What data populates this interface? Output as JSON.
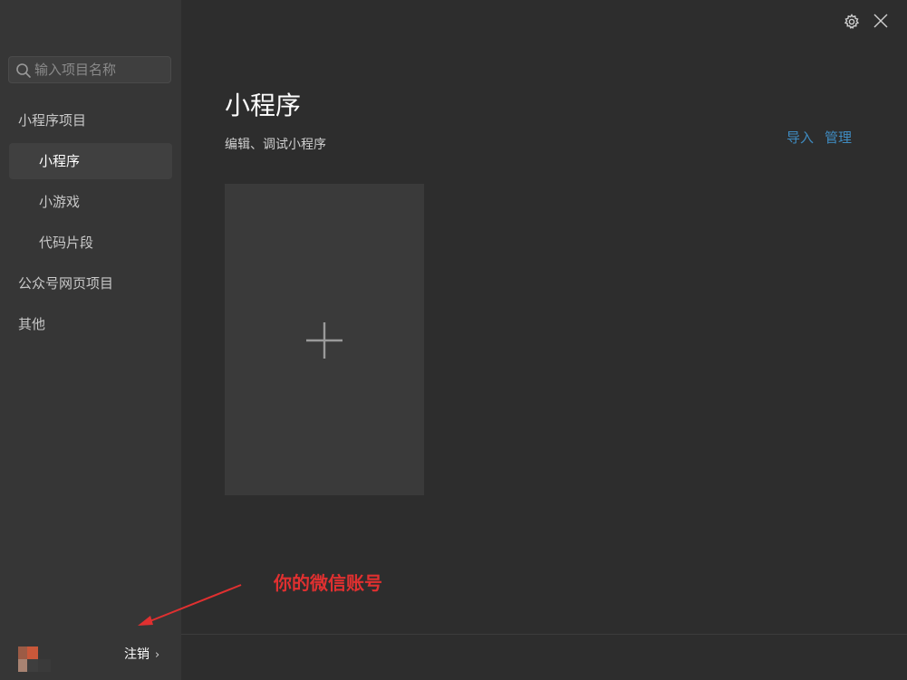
{
  "window": {
    "settings_icon": "gear-icon",
    "close_icon": "close-icon"
  },
  "sidebar": {
    "search": {
      "placeholder": "输入项目名称",
      "icon": "search-icon"
    },
    "sections": [
      {
        "label": "小程序项目"
      },
      {
        "label": "小程序",
        "active": true
      },
      {
        "label": "小游戏"
      },
      {
        "label": "代码片段"
      },
      {
        "label": "公众号网页项目"
      },
      {
        "label": "其他"
      }
    ],
    "user": {
      "logout_label": "注销",
      "chevron": "›"
    }
  },
  "main": {
    "title": "小程序",
    "subtitle": "编辑、调试小程序",
    "links": {
      "import_label": "导入",
      "manage_label": "管理"
    },
    "new_project_icon": "plus-icon"
  },
  "annotation": {
    "text": "你的微信账号"
  },
  "colors": {
    "sidebar_bg": "#363636",
    "main_bg": "#2d2d2d",
    "card_bg": "#3a3a3a",
    "link": "#3f8bc0",
    "annotation": "#e03030"
  }
}
